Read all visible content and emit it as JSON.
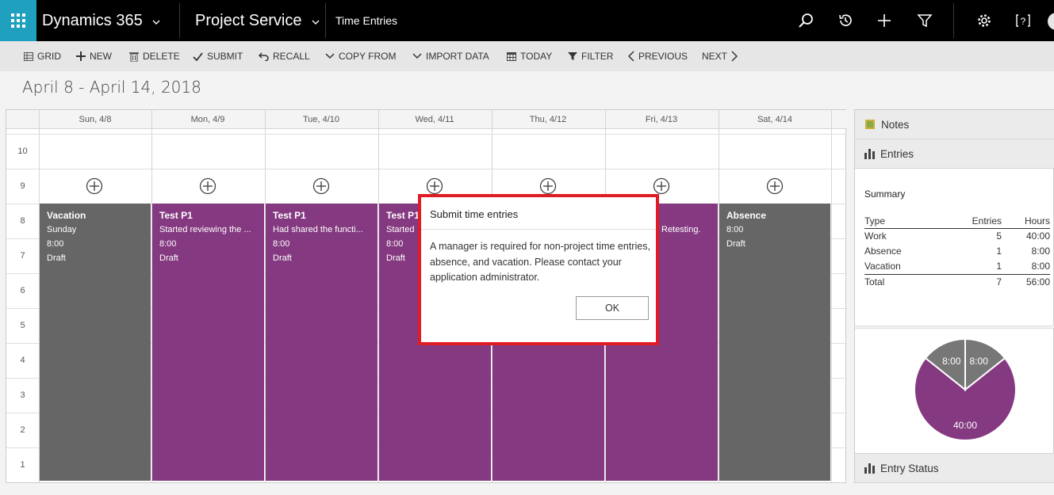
{
  "topnav": {
    "brand": "Dynamics 365",
    "area": "Project Service",
    "entity": "Time Entries",
    "accent": "#1ea0be"
  },
  "toolbar": {
    "grid": "GRID",
    "new": "NEW",
    "delete": "DELETE",
    "submit": "SUBMIT",
    "recall": "RECALL",
    "copy_from": "COPY FROM",
    "import_data": "IMPORT DATA",
    "today": "TODAY",
    "filter": "FILTER",
    "previous": "PREVIOUS",
    "next": "NEXT"
  },
  "date_range": "April 8 - April 14, 2018",
  "calendar": {
    "days": [
      "Sun, 4/8",
      "Mon, 4/9",
      "Tue, 4/10",
      "Wed, 4/11",
      "Thu, 4/12",
      "Fri, 4/13",
      "Sat, 4/14"
    ],
    "hours": [
      "10",
      "9",
      "8",
      "7",
      "6",
      "5",
      "4",
      "3",
      "2",
      "1"
    ],
    "entries": [
      {
        "title": "Vacation",
        "lines": [
          "Sunday",
          "8:00",
          "Draft"
        ],
        "color": "#666666"
      },
      {
        "title": "Test P1",
        "lines": [
          "Started reviewing the ...",
          "8:00",
          "Draft"
        ],
        "color": "#843980"
      },
      {
        "title": "Test P1",
        "lines": [
          "Had shared the functi...",
          "8:00",
          "Draft"
        ],
        "color": "#843980"
      },
      {
        "title": "Test P1",
        "lines": [
          "Started",
          "8:00",
          "Draft"
        ],
        "color": "#843980"
      },
      {
        "title": "",
        "lines": [],
        "color": "#843980"
      },
      {
        "title": "",
        "lines": [
          "Retesting."
        ],
        "color": "#843980"
      },
      {
        "title": "Absence",
        "lines": [
          "8:00",
          "Draft"
        ],
        "color": "#666666"
      }
    ]
  },
  "dialog": {
    "title": "Submit time entries",
    "message": "A manager is required for non-project time entries, absence, and vacation. Please contact your application administrator.",
    "ok": "OK",
    "border_color": "#e01b24"
  },
  "side_panel": {
    "notes": "Notes",
    "entries": "Entries",
    "summary_title": "Summary",
    "summary": {
      "headers": [
        "Type",
        "Entries",
        "Hours"
      ],
      "rows": [
        [
          "Work",
          "5",
          "40:00"
        ],
        [
          "Absence",
          "1",
          "8:00"
        ],
        [
          "Vacation",
          "1",
          "8:00"
        ]
      ],
      "total": [
        "Total",
        "7",
        "56:00"
      ]
    },
    "entry_status": "Entry Status"
  },
  "chart_data": {
    "type": "pie",
    "slices": [
      {
        "label": "40:00",
        "value": 40,
        "color": "#843980"
      },
      {
        "label": "8:00",
        "value": 8,
        "color": "#777777"
      },
      {
        "label": "8:00",
        "value": 8,
        "color": "#777777"
      }
    ]
  }
}
